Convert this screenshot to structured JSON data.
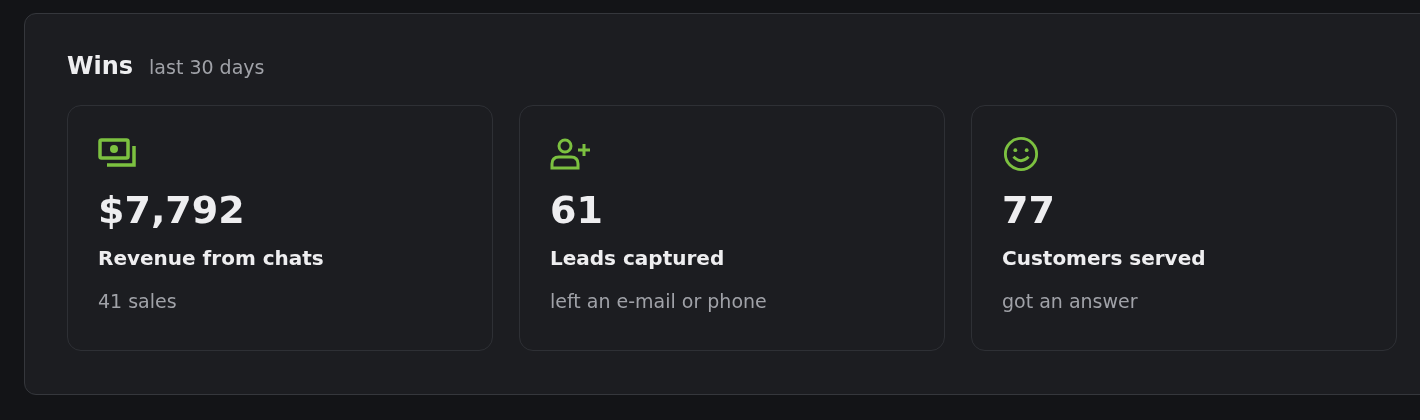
{
  "panel": {
    "title": "Wins",
    "subtitle": "last 30 days"
  },
  "cards": [
    {
      "kind": "money",
      "value": "$7,792",
      "label": "Revenue from chats",
      "detail": "41 sales"
    },
    {
      "kind": "user-plus",
      "value": "61",
      "label": "Leads captured",
      "detail": "left an e-mail or phone"
    },
    {
      "kind": "smile",
      "value": "77",
      "label": "Customers served",
      "detail": "got an answer"
    }
  ]
}
